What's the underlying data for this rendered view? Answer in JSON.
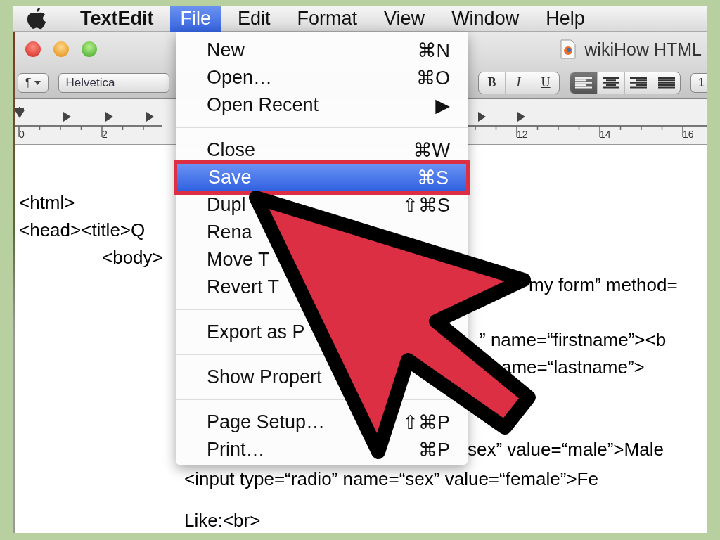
{
  "menu_bar": {
    "items": [
      {
        "label": "TextEdit",
        "kind": "app",
        "selected": false
      },
      {
        "label": "File",
        "kind": "menu",
        "selected": true
      },
      {
        "label": "Edit",
        "kind": "menu",
        "selected": false
      },
      {
        "label": "Format",
        "kind": "menu",
        "selected": false
      },
      {
        "label": "View",
        "kind": "menu",
        "selected": false
      },
      {
        "label": "Window",
        "kind": "menu",
        "selected": false
      },
      {
        "label": "Help",
        "kind": "menu",
        "selected": false
      }
    ]
  },
  "window": {
    "title": "wikiHow HTML"
  },
  "toolbar": {
    "paragraph_button": "¶",
    "font_popup": "Helvetica",
    "style_buttons": [
      {
        "label": "B",
        "kind": "bold"
      },
      {
        "label": "I",
        "kind": "italic"
      },
      {
        "label": "U",
        "kind": "underline"
      }
    ],
    "align_buttons": [
      {
        "kind": "left",
        "selected": true
      },
      {
        "kind": "center",
        "selected": false
      },
      {
        "kind": "right",
        "selected": false
      },
      {
        "kind": "justify",
        "selected": false
      }
    ],
    "size_button": "1"
  },
  "ruler": {
    "labels": [
      "0",
      "2",
      "12",
      "14",
      "16"
    ]
  },
  "document": {
    "lines": [
      {
        "text": "<html>"
      },
      {
        "text": "<head><title>Q"
      },
      {
        "text": "\t<body>"
      },
      {
        "text": "my form” method="
      },
      {
        "text": "” name=“firstname”><b"
      },
      {
        "text": "ame=“lastname”>"
      },
      {
        "text": "sex” value=“male”>Male"
      },
      {
        "text": "<input type=“radio” name=“sex” value=“female”>Fe"
      },
      {
        "text": "Like:<br>"
      }
    ]
  },
  "file_menu": {
    "items": [
      {
        "kind": "item",
        "label": "New",
        "shortcut": "⌘N",
        "selected": false
      },
      {
        "kind": "item",
        "label": "Open…",
        "shortcut": "⌘O",
        "selected": false
      },
      {
        "kind": "item",
        "label": "Open Recent",
        "shortcut": "▶",
        "selected": false
      },
      {
        "kind": "separator"
      },
      {
        "kind": "item",
        "label": "Close",
        "shortcut": "⌘W",
        "selected": false
      },
      {
        "kind": "item",
        "label": "Save",
        "shortcut": "⌘S",
        "selected": true,
        "outlined": true
      },
      {
        "kind": "item",
        "label": "Dupl",
        "shortcut": "⇧⌘S",
        "selected": false
      },
      {
        "kind": "item",
        "label": "Rena",
        "selected": false
      },
      {
        "kind": "item",
        "label": "Move T",
        "selected": false
      },
      {
        "kind": "item",
        "label": "Revert T",
        "selected": false
      },
      {
        "kind": "separator"
      },
      {
        "kind": "item",
        "label": "Export as P",
        "selected": false
      },
      {
        "kind": "separator"
      },
      {
        "kind": "item",
        "label": "Show Propert",
        "selected": false
      },
      {
        "kind": "separator"
      },
      {
        "kind": "item",
        "label": "Page Setup…",
        "shortcut": "⇧⌘P",
        "selected": false
      },
      {
        "kind": "item",
        "label": "Print…",
        "shortcut": "⌘P",
        "selected": false
      }
    ]
  },
  "overlay": {
    "kind": "arrow"
  }
}
